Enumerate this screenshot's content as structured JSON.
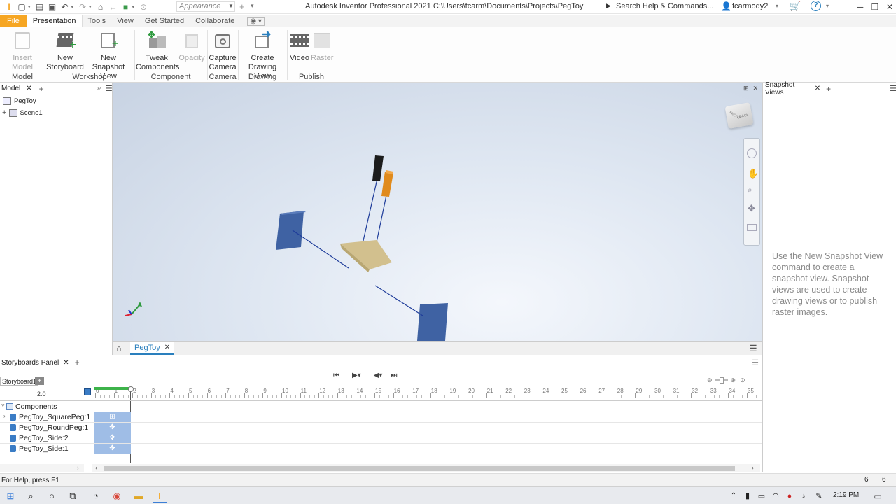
{
  "titlebar": {
    "app_title": "Autodesk Inventor Professional 2021   C:\\Users\\fcarm\\Documents\\Projects\\PegToy",
    "appearance": "Appearance",
    "search": "Search Help & Commands...",
    "user": "fcarmody2"
  },
  "tabs": [
    "File",
    "Presentation",
    "Tools",
    "View",
    "Get Started",
    "Collaborate"
  ],
  "ribbon": {
    "insert_model": "Insert Model",
    "new_storyboard": [
      "New",
      "Storyboard"
    ],
    "new_snapshot": [
      "New",
      "Snapshot View"
    ],
    "tweak": [
      "Tweak",
      "Components"
    ],
    "opacity": "Opacity",
    "capture": [
      "Capture",
      "Camera"
    ],
    "create_drawing": [
      "Create",
      "Drawing View"
    ],
    "video": "Video",
    "raster": "Raster",
    "groups": [
      "Model",
      "Workshop",
      "Component",
      "Camera",
      "Drawing",
      "Publish"
    ]
  },
  "browser": {
    "tab": "Model",
    "root": "PegToy",
    "scene": "Scene1"
  },
  "viewcube": {
    "face_a": "FRONT",
    "face_b": "BACK"
  },
  "document_tab": "PegToy",
  "snapshot": {
    "tab": "Snapshot Views",
    "help": "Use the New Snapshot View command to create a snapshot view. Snapshot views are used to create drawing views or to publish raster images."
  },
  "storyboard": {
    "tab": "Storyboards Panel",
    "storyboard_name": "Storyboard1",
    "time": "2.0",
    "tick_labels": [
      "0",
      "1",
      "2",
      "3",
      "4",
      "5",
      "6",
      "7",
      "8",
      "9",
      "10",
      "11",
      "12",
      "13",
      "14",
      "15",
      "16",
      "17",
      "18",
      "19",
      "20",
      "21",
      "22",
      "23",
      "24",
      "25",
      "26",
      "27",
      "28",
      "29",
      "30",
      "31",
      "32",
      "33",
      "34",
      "35"
    ],
    "tree_root": "Components",
    "tracks": [
      "PegToy_SquarePeg:1",
      "PegToy_RoundPeg:1",
      "PegToy_Side:2",
      "PegToy_Side:1"
    ]
  },
  "status": {
    "help": "For Help, press F1",
    "num_a": "6",
    "num_b": "6"
  },
  "taskbar": {
    "time": "2:19 PM"
  }
}
